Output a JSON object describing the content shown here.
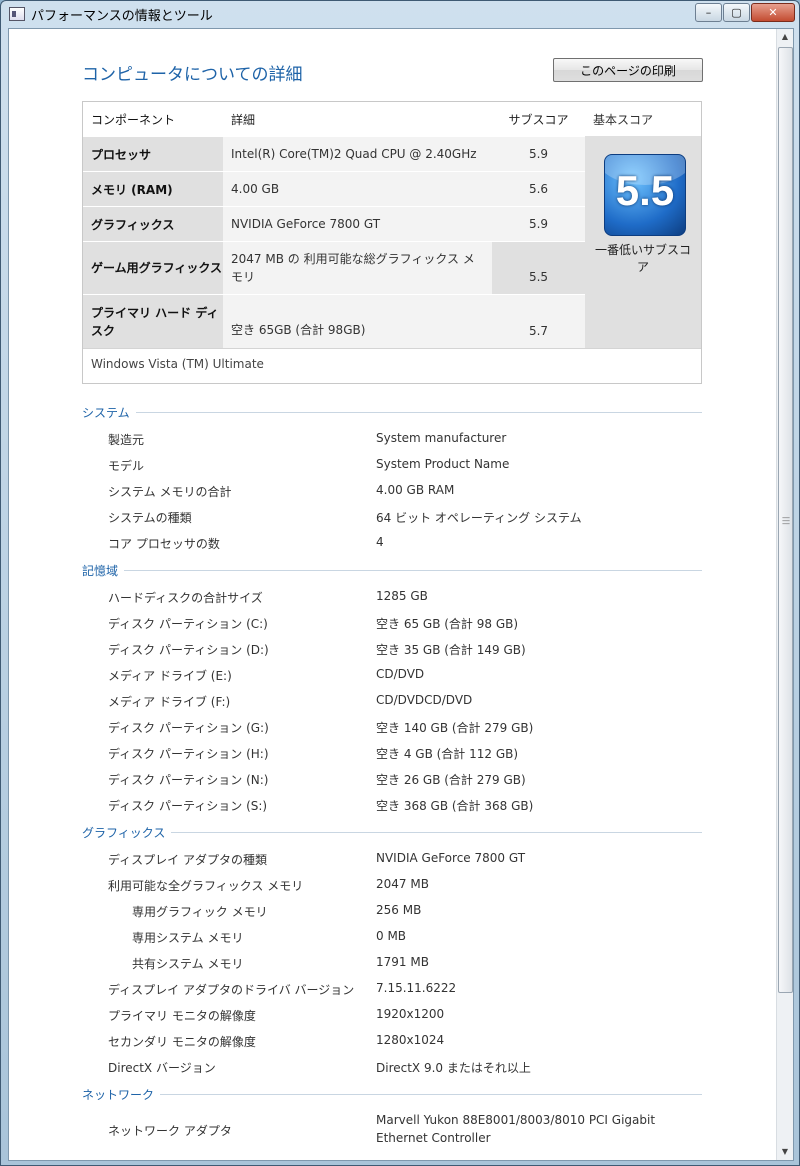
{
  "window": {
    "title": "パフォーマンスの情報とツール",
    "minimize": "–",
    "maximize": "▢",
    "close": "✕"
  },
  "page_title": "コンピュータについての詳細",
  "print_button": "このページの印刷",
  "score_table": {
    "headers": {
      "component": "コンポーネント",
      "detail": "詳細",
      "subscore": "サブスコア",
      "base": "基本スコア"
    },
    "rows": [
      {
        "component": "プロセッサ",
        "detail": "Intel(R) Core(TM)2 Quad CPU @ 2.40GHz",
        "score": "5.9"
      },
      {
        "component": "メモリ (RAM)",
        "detail": "4.00 GB",
        "score": "5.6"
      },
      {
        "component": "グラフィックス",
        "detail": "NVIDIA GeForce 7800 GT",
        "score": "5.9"
      },
      {
        "component": "ゲーム用グラフィックス",
        "detail": "2047 MB の 利用可能な総グラフィックス メモリ",
        "score": "5.5"
      },
      {
        "component": "プライマリ ハード ディスク",
        "detail": "空き 65GB (合計 98GB)",
        "score": "5.7"
      }
    ],
    "base_score": "5.5",
    "base_label": "一番低いサブスコア",
    "os": "Windows Vista (TM) Ultimate"
  },
  "sections": {
    "system": {
      "title": "システム",
      "rows": [
        {
          "label": "製造元",
          "value": "System manufacturer"
        },
        {
          "label": "モデル",
          "value": "System Product Name"
        },
        {
          "label": "システム メモリの合計",
          "value": "4.00 GB RAM"
        },
        {
          "label": "システムの種類",
          "value": "64 ビット オペレーティング システム"
        },
        {
          "label": "コア プロセッサの数",
          "value": "4"
        }
      ]
    },
    "storage": {
      "title": "記憶域",
      "rows": [
        {
          "label": "ハードディスクの合計サイズ",
          "value": "1285 GB"
        },
        {
          "label": "ディスク パーティション (C:)",
          "value": "空き 65 GB (合計 98 GB)"
        },
        {
          "label": "ディスク パーティション (D:)",
          "value": "空き 35 GB (合計 149 GB)"
        },
        {
          "label": "メディア ドライブ (E:)",
          "value": "CD/DVD"
        },
        {
          "label": "メディア ドライブ (F:)",
          "value": "CD/DVDCD/DVD"
        },
        {
          "label": "ディスク パーティション (G:)",
          "value": "空き 140 GB (合計 279 GB)"
        },
        {
          "label": "ディスク パーティション (H:)",
          "value": "空き 4 GB (合計 112 GB)"
        },
        {
          "label": "ディスク パーティション (N:)",
          "value": "空き 26 GB (合計 279 GB)"
        },
        {
          "label": "ディスク パーティション (S:)",
          "value": "空き 368 GB (合計 368 GB)"
        }
      ]
    },
    "graphics": {
      "title": "グラフィックス",
      "rows": [
        {
          "label": "ディスプレイ アダプタの種類",
          "value": "NVIDIA GeForce 7800 GT"
        },
        {
          "label": "利用可能な全グラフィックス メモリ",
          "value": "2047 MB"
        },
        {
          "label": "専用グラフィック メモリ",
          "value": "256 MB"
        },
        {
          "label": "専用システム メモリ",
          "value": "0 MB"
        },
        {
          "label": "共有システム メモリ",
          "value": "1791 MB"
        },
        {
          "label": "ディスプレイ アダプタのドライバ バージョン",
          "value": "7.15.11.6222"
        },
        {
          "label": "プライマリ モニタの解像度",
          "value": "1920x1200"
        },
        {
          "label": "セカンダリ モニタの解像度",
          "value": "1280x1024"
        },
        {
          "label": "DirectX バージョン",
          "value": "DirectX 9.0 またはそれ以上"
        }
      ]
    },
    "network": {
      "title": "ネットワーク",
      "rows": [
        {
          "label": "ネットワーク アダプタ",
          "value_line1": "Marvell Yukon 88E8001/8003/8010 PCI Gigabit",
          "value_line2": "Ethernet Controller"
        }
      ]
    }
  }
}
